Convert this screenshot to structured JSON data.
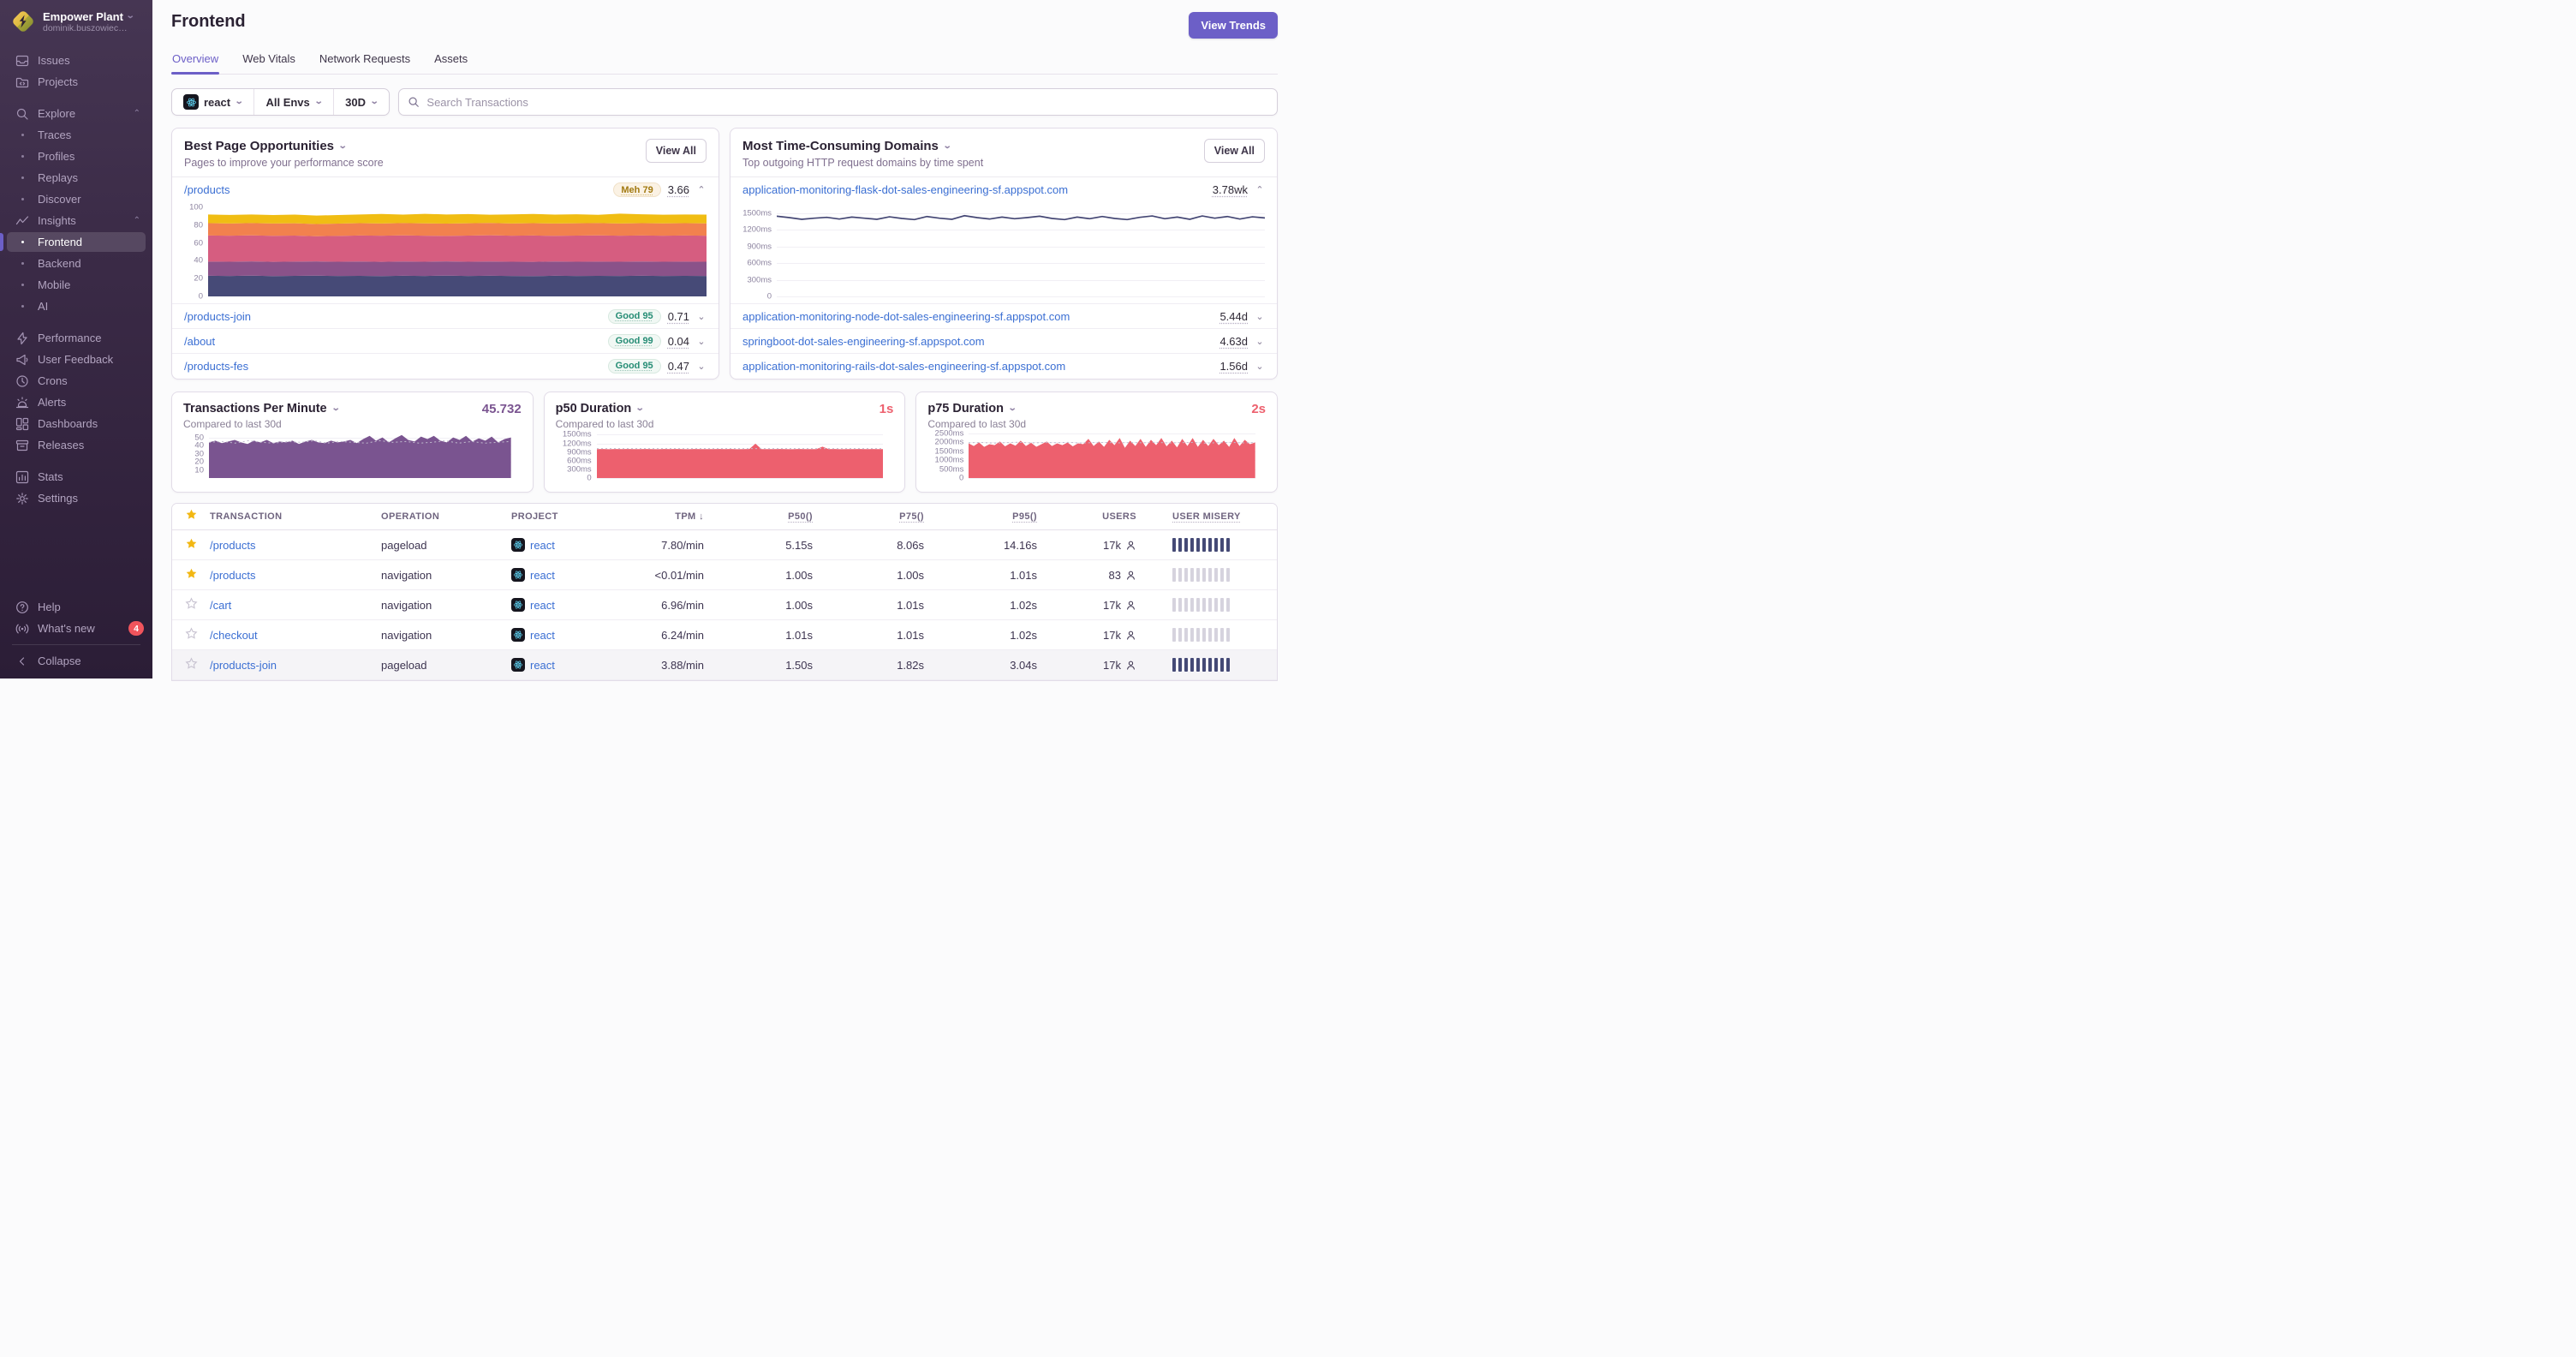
{
  "org": {
    "name": "Empower Plant",
    "subtitle": "dominik.buszowiec…"
  },
  "sidebar": {
    "sections": [
      {
        "items": [
          {
            "icon": "issues",
            "label": "Issues"
          },
          {
            "icon": "projects",
            "label": "Projects"
          }
        ]
      },
      {
        "items": [
          {
            "icon": "search",
            "label": "Explore",
            "chevron": "up"
          },
          {
            "bullet": true,
            "label": "Traces"
          },
          {
            "bullet": true,
            "label": "Profiles"
          },
          {
            "bullet": true,
            "label": "Replays"
          },
          {
            "bullet": true,
            "label": "Discover"
          },
          {
            "icon": "insights",
            "label": "Insights",
            "chevron": "up"
          },
          {
            "bullet": true,
            "label": "Frontend",
            "active": true
          },
          {
            "bullet": true,
            "label": "Backend"
          },
          {
            "bullet": true,
            "label": "Mobile"
          },
          {
            "bullet": true,
            "label": "AI"
          }
        ]
      },
      {
        "items": [
          {
            "icon": "performance",
            "label": "Performance"
          },
          {
            "icon": "feedback",
            "label": "User Feedback"
          },
          {
            "icon": "crons",
            "label": "Crons"
          },
          {
            "icon": "alerts",
            "label": "Alerts"
          },
          {
            "icon": "dashboards",
            "label": "Dashboards"
          },
          {
            "icon": "releases",
            "label": "Releases"
          }
        ]
      },
      {
        "items": [
          {
            "icon": "stats",
            "label": "Stats"
          },
          {
            "icon": "settings",
            "label": "Settings"
          }
        ]
      }
    ],
    "footer": [
      {
        "icon": "help",
        "label": "Help"
      },
      {
        "icon": "broadcast",
        "label": "What's new",
        "badge": "4"
      },
      {
        "icon": "collapse",
        "label": "Collapse",
        "divider_before": true
      }
    ]
  },
  "header": {
    "title": "Frontend",
    "action": "View Trends",
    "tabs": [
      {
        "label": "Overview",
        "active": true
      },
      {
        "label": "Web Vitals"
      },
      {
        "label": "Network Requests"
      },
      {
        "label": "Assets"
      }
    ]
  },
  "filters": {
    "project": "react",
    "env": "All Envs",
    "period": "30D",
    "search_placeholder": "Search Transactions"
  },
  "opportunities": {
    "title": "Best Page Opportunities",
    "subtitle": "Pages to improve your performance score",
    "view_all": "View All",
    "rows": [
      {
        "page": "/products",
        "badge": "Meh 79",
        "badge_kind": "meh",
        "score": "3.66",
        "expanded": true
      },
      {
        "page": "/products-join",
        "badge": "Good 95",
        "badge_kind": "good",
        "score": "0.71"
      },
      {
        "page": "/about",
        "badge": "Good 99",
        "badge_kind": "good",
        "score": "0.04"
      },
      {
        "page": "/products-fes",
        "badge": "Good 95",
        "badge_kind": "good",
        "score": "0.47"
      }
    ]
  },
  "domains": {
    "title": "Most Time-Consuming Domains",
    "subtitle": "Top outgoing HTTP request domains by time spent",
    "view_all": "View All",
    "rows": [
      {
        "domain": "application-monitoring-flask-dot-sales-engineering-sf.appspot.com",
        "time": "3.78wk",
        "expanded": true
      },
      {
        "domain": "application-monitoring-node-dot-sales-engineering-sf.appspot.com",
        "time": "5.44d"
      },
      {
        "domain": "springboot-dot-sales-engineering-sf.appspot.com",
        "time": "4.63d"
      },
      {
        "domain": "application-monitoring-rails-dot-sales-engineering-sf.appspot.com",
        "time": "1.56d"
      }
    ]
  },
  "minis": [
    {
      "title": "Transactions Per Minute",
      "value": "45.732",
      "subtitle": "Compared to last 30d",
      "value_color": "#7a5490",
      "chart": "tpm"
    },
    {
      "title": "p50 Duration",
      "value": "1s",
      "subtitle": "Compared to last 30d",
      "value_color": "#ed606e",
      "chart": "p50"
    },
    {
      "title": "p75 Duration",
      "value": "2s",
      "subtitle": "Compared to last 30d",
      "value_color": "#ed606e",
      "chart": "p75"
    }
  ],
  "table": {
    "sort_icon": "↓",
    "columns": [
      "TRANSACTION",
      "OPERATION",
      "PROJECT",
      "TPM",
      "P50()",
      "P75()",
      "P95()",
      "USERS",
      "USER MISERY"
    ],
    "rows": [
      {
        "fav": true,
        "transaction": "/products",
        "operation": "pageload",
        "project": "react",
        "tpm": "7.80/min",
        "p50": "5.15s",
        "p75": "8.06s",
        "p95": "14.16s",
        "users": "17k",
        "misery": "high"
      },
      {
        "fav": true,
        "transaction": "/products",
        "operation": "navigation",
        "project": "react",
        "tpm": "<0.01/min",
        "p50": "1.00s",
        "p75": "1.00s",
        "p95": "1.01s",
        "users": "83",
        "misery": "low"
      },
      {
        "fav": false,
        "transaction": "/cart",
        "operation": "navigation",
        "project": "react",
        "tpm": "6.96/min",
        "p50": "1.00s",
        "p75": "1.01s",
        "p95": "1.02s",
        "users": "17k",
        "misery": "low"
      },
      {
        "fav": false,
        "transaction": "/checkout",
        "operation": "navigation",
        "project": "react",
        "tpm": "6.24/min",
        "p50": "1.01s",
        "p75": "1.01s",
        "p95": "1.02s",
        "users": "17k",
        "misery": "low"
      },
      {
        "fav": false,
        "transaction": "/products-join",
        "operation": "pageload",
        "project": "react",
        "tpm": "3.88/min",
        "p50": "1.50s",
        "p75": "1.82s",
        "p95": "3.04s",
        "users": "17k",
        "misery": "high",
        "highlight": true
      }
    ]
  },
  "charts": {
    "opportunities": {
      "type": "stacked",
      "title": "Performance score components for /products",
      "ymax": 100,
      "grid": "none",
      "yticks": [
        {
          "v": 100,
          "t": "100"
        },
        {
          "v": 80,
          "t": "80"
        },
        {
          "v": 60,
          "t": "60"
        },
        {
          "v": 40,
          "t": "40"
        },
        {
          "v": 20,
          "t": "20"
        },
        {
          "v": 0,
          "t": "0"
        }
      ],
      "colors": [
        "#464a77",
        "#8a5289",
        "#d65d80",
        "#f2814e",
        "#f0bd13"
      ],
      "tops": [
        [
          23.2,
          23,
          23.3,
          22.8,
          23.1,
          23.3,
          22.9,
          23.1,
          22.8,
          23.2,
          23,
          23.3,
          22.9,
          23.2,
          23,
          22.8,
          23.2,
          23,
          23.1,
          22.9,
          23.2,
          23,
          23.1,
          23
        ],
        [
          39.1,
          38.9,
          39.3,
          38.8,
          39.1,
          39.3,
          38.9,
          39.2,
          38.8,
          39.2,
          39,
          39.3,
          38.9,
          39.2,
          39,
          38.8,
          39.2,
          39,
          39.1,
          38.9,
          39.2,
          39,
          39.1,
          39
        ],
        [
          68.4,
          68.1,
          68.5,
          68,
          68.3,
          67.6,
          67.9,
          68.4,
          68.1,
          68.5,
          68.2,
          67.9,
          68.3,
          68.6,
          68.1,
          68.4,
          68,
          68.3,
          68.5,
          68.1,
          68.4,
          68.2,
          68.4,
          68.2
        ],
        [
          82.2,
          81.9,
          82.3,
          81.8,
          82.1,
          81.3,
          81.7,
          82.2,
          81.9,
          82.3,
          82,
          81.7,
          82.1,
          82.4,
          81.9,
          82.2,
          81.8,
          82.1,
          82.3,
          81.9,
          82.2,
          82,
          82.2,
          82
        ],
        [
          91.9,
          91.5,
          92,
          91.4,
          91.8,
          90.8,
          91.3,
          92,
          92.5,
          91.8,
          92.7,
          92,
          92.4,
          91.7,
          92.1,
          92.5,
          91.8,
          92.2,
          91.6,
          92.9,
          92.2,
          91.7,
          92,
          91.8
        ]
      ]
    },
    "domains": {
      "type": "line",
      "title": "Time spent for application-monitoring-flask",
      "ymax": 1600,
      "grid": "all",
      "color": "#444674",
      "yticks": [
        {
          "v": 1500,
          "t": "1500ms"
        },
        {
          "v": 1200,
          "t": "1200ms"
        },
        {
          "v": 900,
          "t": "900ms"
        },
        {
          "v": 600,
          "t": "600ms"
        },
        {
          "v": 300,
          "t": "300ms"
        },
        {
          "v": 0,
          "t": "0"
        }
      ],
      "values": [
        1440,
        1415,
        1385,
        1405,
        1420,
        1390,
        1425,
        1405,
        1385,
        1430,
        1400,
        1380,
        1435,
        1405,
        1385,
        1450,
        1415,
        1390,
        1425,
        1395,
        1415,
        1440,
        1400,
        1380,
        1425,
        1395,
        1435,
        1400,
        1380,
        1420,
        1445,
        1395,
        1425,
        1385,
        1445,
        1405,
        1435,
        1390,
        1430,
        1410
      ]
    },
    "tpm": {
      "type": "area",
      "title": "Transactions Per Minute",
      "ymax": 57,
      "grid": "all",
      "color": "#7a5490",
      "yticks": [
        {
          "v": 50,
          "t": "50"
        },
        {
          "v": 40,
          "t": "40"
        },
        {
          "v": 30,
          "t": "30"
        },
        {
          "v": 20,
          "t": "20"
        },
        {
          "v": 10,
          "t": "10"
        }
      ],
      "values": [
        44,
        46,
        43,
        45,
        47,
        44,
        42,
        46,
        44,
        47,
        43,
        45,
        44,
        46,
        42,
        45,
        47,
        44,
        43,
        46,
        44,
        45,
        47,
        43,
        48,
        52,
        46,
        50,
        44,
        49,
        53,
        47,
        45,
        51,
        48,
        52,
        46,
        44,
        50,
        47,
        52,
        45,
        49,
        46,
        51,
        44,
        48,
        50
      ],
      "dash": {
        "color": "#c1bbce",
        "values": [
          44,
          45,
          43,
          46,
          44,
          43,
          45,
          44,
          46,
          43,
          45,
          44,
          43,
          46,
          44,
          45,
          43,
          44,
          46,
          43,
          45,
          43,
          44,
          45
        ]
      }
    },
    "p50": {
      "type": "area",
      "title": "p50 Duration",
      "ymax": 1600,
      "grid": "all",
      "color": "#ed606e",
      "yticks": [
        {
          "v": 1500,
          "t": "1500ms"
        },
        {
          "v": 1200,
          "t": "1200ms"
        },
        {
          "v": 900,
          "t": "900ms"
        },
        {
          "v": 600,
          "t": "600ms"
        },
        {
          "v": 300,
          "t": "300ms"
        },
        {
          "v": 0,
          "t": "0"
        }
      ],
      "values": [
        1000,
        1005,
        998,
        1002,
        1000,
        1004,
        999,
        1001,
        1003,
        1000,
        998,
        1002,
        1000,
        1004,
        1000,
        998,
        1003,
        1000,
        1001,
        999,
        1002,
        1000,
        1004,
        998,
        1000,
        1002,
        1190,
        1000,
        1001,
        999,
        1002,
        1000,
        998,
        1003,
        1000,
        1001,
        999,
        1085,
        1000,
        1002,
        998,
        1001,
        1000,
        1003,
        999,
        1002,
        1000,
        1001
      ],
      "dash": {
        "color": "#c1bbce",
        "values": [
          1020,
          1020,
          1020,
          1020
        ]
      }
    },
    "p75": {
      "type": "area",
      "title": "p75 Duration",
      "ymax": 2600,
      "grid": "all",
      "color": "#ed606e",
      "yticks": [
        {
          "v": 2500,
          "t": "2500ms"
        },
        {
          "v": 2000,
          "t": "2000ms"
        },
        {
          "v": 1500,
          "t": "1500ms"
        },
        {
          "v": 1000,
          "t": "1000ms"
        },
        {
          "v": 500,
          "t": "500ms"
        },
        {
          "v": 0,
          "t": "0"
        }
      ],
      "values": [
        1950,
        1800,
        2000,
        1750,
        1900,
        1850,
        2050,
        1780,
        1950,
        1820,
        2100,
        1800,
        1980,
        1760,
        1900,
        2050,
        1800,
        1950,
        1850,
        2000,
        1780,
        1950,
        1900,
        2200,
        1800,
        2050,
        1750,
        2150,
        1850,
        2250,
        1700,
        2100,
        1800,
        2200,
        1750,
        2150,
        1850,
        2250,
        1780,
        2100,
        1720,
        2200,
        1800,
        2250,
        1750,
        2150,
        1800,
        2200,
        1850,
        2100,
        1750,
        2250,
        1800,
        2150,
        1900,
        2000
      ],
      "dash": {
        "color": "#c1bbce",
        "values": [
          1980,
          2000,
          1960,
          1990,
          2010,
          1970,
          1995,
          1985,
          2005,
          1965,
          1990,
          2000,
          1975,
          1995,
          1980,
          2010,
          1970,
          1990,
          2000,
          1960,
          1985,
          2005,
          1975,
          1995
        ]
      }
    }
  }
}
